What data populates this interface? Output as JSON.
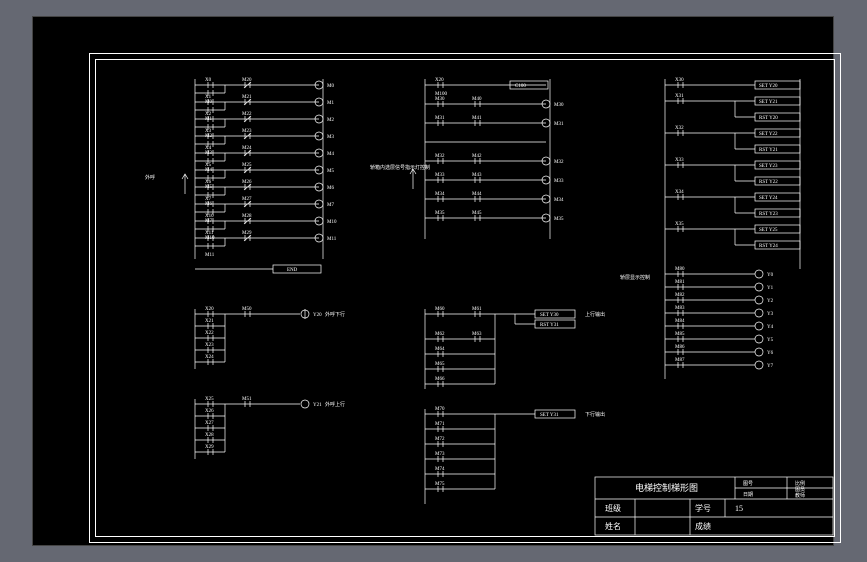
{
  "labels": {
    "left_group": "外呼",
    "left_bottom1": "外呼下行",
    "left_bottom2": "外呼上行",
    "middle_group": "轿箱内选层信号指示灯控制",
    "middle_bottom1": "上行输出",
    "middle_bottom2": "下行输出",
    "right_group": "轿层显示控制"
  },
  "title_block": {
    "main_title": "电梯控制梯形图",
    "row1_left": "班级",
    "row1_mid": "学号",
    "row1_val": "15",
    "row2_left": "姓名",
    "row2_mid": "成绩",
    "tuhao": "图号",
    "riqi": "日期",
    "bili": "比例",
    "tuyuan": "图员",
    "jiaoshi": "教师"
  },
  "scheme": {
    "left_rungs": [
      {
        "a": "X0",
        "b": "M20",
        "o": "M0"
      },
      {
        "a": "X1",
        "b": "M21",
        "o": "M1"
      },
      {
        "a": "X2",
        "b": "M22",
        "o": "M2"
      },
      {
        "a": "X3",
        "b": "M23",
        "o": "M3"
      },
      {
        "a": "X4",
        "b": "M24",
        "o": "M4"
      },
      {
        "a": "X5",
        "b": "M25",
        "o": "M5"
      },
      {
        "a": "X6",
        "b": "M26",
        "o": "M6"
      },
      {
        "a": "X7",
        "b": "M27",
        "o": "M7"
      },
      {
        "a": "X10",
        "b": "M28",
        "o": "M10"
      },
      {
        "a": "X11",
        "b": "M29",
        "o": "M11"
      }
    ],
    "left_end": "END",
    "mid_rungs": [
      {
        "a": "X20",
        "b": "",
        "o": "M100",
        "ext": "C100"
      },
      {
        "a": "M30",
        "b": "M40",
        "o": "M30"
      },
      {
        "a": "M31",
        "b": "M41",
        "o": "M31"
      },
      {
        "a": "",
        "b": "",
        "o": ""
      },
      {
        "a": "M32",
        "b": "M42",
        "o": "M32"
      },
      {
        "a": "M33",
        "b": "M43",
        "o": "M33"
      },
      {
        "a": "M34",
        "b": "M44",
        "o": "M34"
      },
      {
        "a": "M35",
        "b": "M45",
        "o": "M35"
      }
    ],
    "right_rungs": [
      {
        "a": "X30",
        "o": "",
        "box": "SET Y20"
      },
      {
        "a": "X31",
        "o": "",
        "box": "SET Y21"
      },
      {
        "a": "",
        "o": "",
        "box": "RST Y20"
      },
      {
        "a": "X32",
        "o": "",
        "box": "SET Y22"
      },
      {
        "a": "",
        "o": "",
        "box": "RST Y21"
      },
      {
        "a": "X33",
        "o": "",
        "box": "SET Y23"
      },
      {
        "a": "",
        "o": "",
        "box": "RST Y22"
      },
      {
        "a": "X34",
        "o": "",
        "box": "SET Y24"
      },
      {
        "a": "",
        "o": "",
        "box": "RST Y23"
      },
      {
        "a": "X35",
        "o": "",
        "box": "SET Y25"
      },
      {
        "a": "",
        "o": "",
        "box": "RST Y24"
      }
    ],
    "right_outputs": [
      "Y0",
      "Y1",
      "Y2",
      "Y3",
      "Y4",
      "Y5",
      "Y6",
      "Y7"
    ]
  }
}
